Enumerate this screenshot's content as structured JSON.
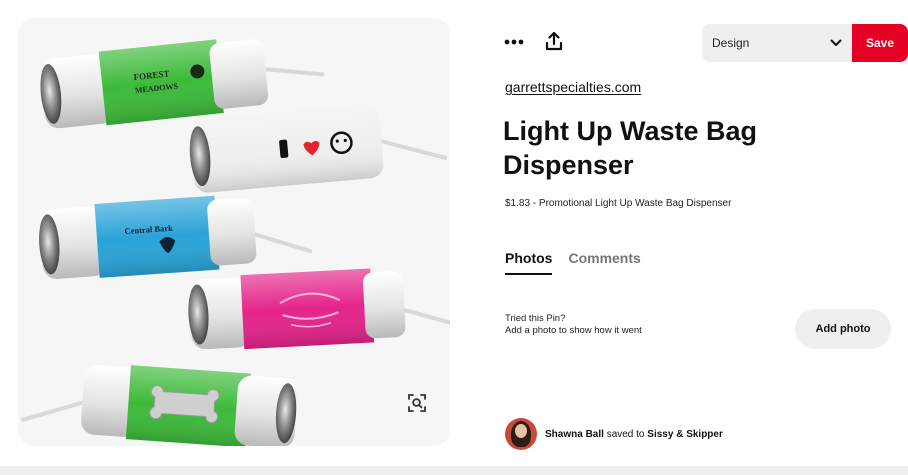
{
  "toolbar": {
    "more_icon": "more-horizontal-icon",
    "share_icon": "share-icon",
    "board_label": "Design",
    "dropdown_icon": "chevron-down-icon",
    "save_label": "Save"
  },
  "pin": {
    "source": "garrettspecialties.com",
    "title": "Light Up Waste Bag Dispenser",
    "description": "$1.83 - Promotional Light Up Waste Bag Dispenser"
  },
  "tabs": [
    {
      "label": "Photos",
      "active": true
    },
    {
      "label": "Comments",
      "active": false
    }
  ],
  "tried": {
    "line1": "Tried this Pin?",
    "line2": "Add a photo to show how it went",
    "button": "Add photo"
  },
  "saved_by": {
    "user": "Shawna Ball",
    "verb": "saved to",
    "board": "Sissy & Skipper"
  },
  "image": {
    "dispensers": [
      {
        "color": "#3dba3a",
        "print": "FOREST MEADOWS"
      },
      {
        "color": "#ececec",
        "print": ""
      },
      {
        "color": "#2aa3d8",
        "print": "Central Bark"
      },
      {
        "color": "#e4248a",
        "print": ""
      },
      {
        "color": "#3dba3a",
        "print": ""
      }
    ]
  },
  "colors": {
    "save": "#e60023",
    "pill": "#efefef"
  }
}
